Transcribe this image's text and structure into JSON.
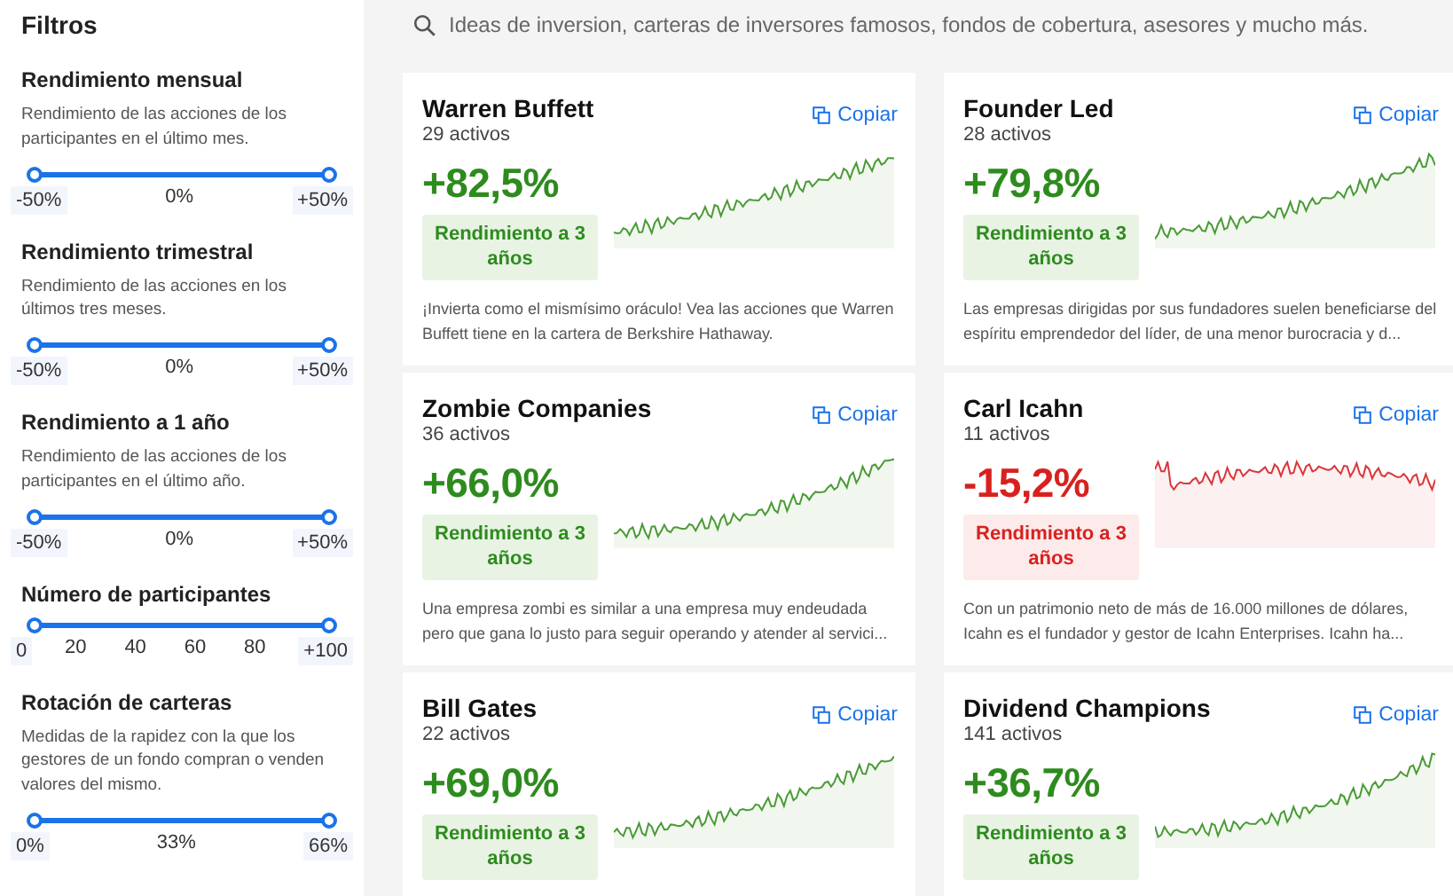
{
  "sidebar": {
    "title": "Filtros",
    "filters": [
      {
        "title": "Rendimiento mensual",
        "description": "Rendimiento de las acciones de los participantes en el último mes.",
        "thumbs": [
          {
            "level": 0
          },
          {
            "level": 1
          }
        ],
        "labels": [
          "-50%",
          "0%",
          "+50%"
        ]
      },
      {
        "title": "Rendimiento trimestral",
        "description": "Rendimiento de las acciones en los últimos tres meses.",
        "thumbs": [
          {
            "level": 0
          },
          {
            "level": 1
          }
        ],
        "labels": [
          "-50%",
          "0%",
          "+50%"
        ]
      },
      {
        "title": "Rendimiento a 1 año",
        "description": "Rendimiento de las acciones de los participantes en el último año.",
        "thumbs": [
          {
            "level": 0
          },
          {
            "level": 1
          }
        ],
        "labels": [
          "-50%",
          "0%",
          "+50%"
        ]
      },
      {
        "title": "Número de participantes",
        "thumbs": [
          {
            "level": 0
          },
          {
            "level": 1
          }
        ],
        "labels": [
          "0",
          "20",
          "40",
          "60",
          "80",
          "+100"
        ]
      },
      {
        "title": "Rotación de carteras",
        "description": "Medidas de la rapidez con la que los gestores de un fondo compran o venden valores del mismo.",
        "thumbs": [
          {
            "level": 0
          },
          {
            "level": 1
          }
        ],
        "labels": [
          "0%",
          "33%",
          "66%"
        ]
      }
    ]
  },
  "search": {
    "placeholder": "Ideas de inversion, carteras de inversores famosos, fondos de cobertura, asesores y mucho más."
  },
  "cards": [
    {
      "name": "Warren Buffett",
      "assets": "29 activos",
      "copy": "Copiar",
      "return": "+82,5%",
      "kind": "gain",
      "badge": "Rendimiento a 3 años",
      "description": "¡Invierta como el mismísimo oráculo! Vea las acciones que Warren Buffett tiene en la cartera de Berkshire Hathaway."
    },
    {
      "name": "Founder Led",
      "assets": "28 activos",
      "copy": "Copiar",
      "return": "+79,8%",
      "kind": "gain",
      "badge": "Rendimiento a 3 años",
      "description": "Las empresas dirigidas por sus fundadores suelen beneficiarse del espíritu emprendedor del líder, de una menor burocracia y d..."
    },
    {
      "name": "Zombie Companies",
      "assets": "36 activos",
      "copy": "Copiar",
      "return": "+66,0%",
      "kind": "gain",
      "badge": "Rendimiento a 3 años",
      "description": "Una empresa zombi es similar a una empresa muy endeudada pero que gana lo justo para seguir operando y atender al servici..."
    },
    {
      "name": "Carl Icahn",
      "assets": "11 activos",
      "copy": "Copiar",
      "return": "-15,2%",
      "kind": "loss",
      "badge": "Rendimiento a 3 años",
      "description": "Con un patrimonio neto de más de 16.000 millones de dólares, Icahn es el fundador y gestor de Icahn Enterprises. Icahn ha..."
    },
    {
      "name": "Bill Gates",
      "assets": "22 activos",
      "copy": "Copiar",
      "return": "+69,0%",
      "kind": "gain",
      "badge": "Rendimiento a 3 años"
    },
    {
      "name": "Dividend Champions",
      "assets": "141 activos",
      "copy": "Copiar",
      "return": "+36,7%",
      "kind": "gain",
      "badge": "Rendimiento a 3 años"
    }
  ]
}
